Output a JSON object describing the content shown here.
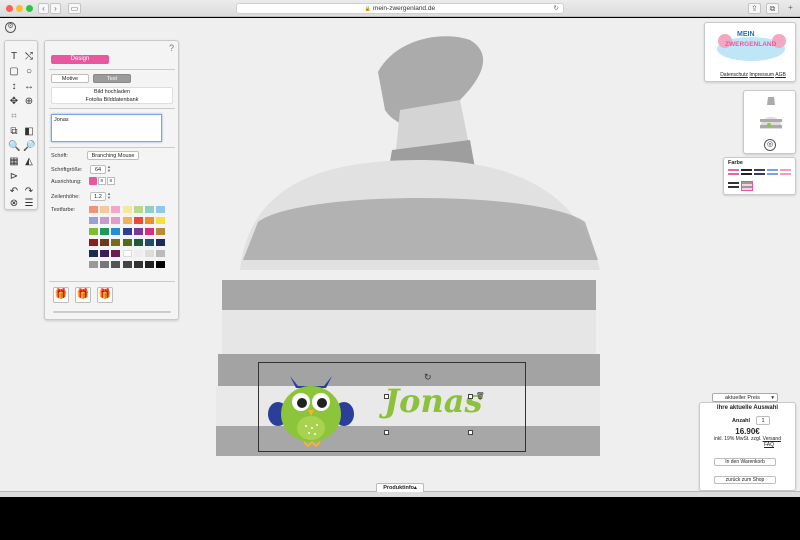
{
  "browser": {
    "url": "mein-zwergenland.de"
  },
  "designer": {
    "help_label": "?",
    "design_tab": "Design",
    "motive_tab": "Motive",
    "text_tab": "Text",
    "upload_label": "Bild hochladen",
    "fotolia_label": "Fotolia Bilddatenbank",
    "text_value": "Jonas",
    "font_label": "Schrift:",
    "font_value": "Branching Mouse",
    "size_label": "Schriftgröße:",
    "size_value": "64",
    "align_label": "Ausrichtung:",
    "lineheight_label": "Zeilenhöhe:",
    "lineheight_value": "1.2",
    "textcolor_label": "Textfarbe:",
    "palette": [
      "#f0937a",
      "#f6c7a0",
      "#f4a6c6",
      "#f7e79b",
      "#b9d98a",
      "#8fd0c4",
      "#8fc8ee",
      "#9aa0d6",
      "#c59ad3",
      "#e59ac9",
      "#f4b14f",
      "#e94a3a",
      "#f08c2b",
      "#f6e03c",
      "#7fba2f",
      "#1c9a5a",
      "#1f8fd6",
      "#2f3e8f",
      "#7a3a94",
      "#d62f7d",
      "#b88a3a",
      "#8b1e1e",
      "#6a3b1e",
      "#7a6a1e",
      "#4e6b1e",
      "#1e5a3a",
      "#1e4e6b",
      "#1e2a5a",
      "#1e2a4e",
      "#3a1e5a",
      "#6a1e4e",
      "#ffffff",
      "#eeeeee",
      "#dddddd",
      "#bbbbbb",
      "#999999",
      "#777777",
      "#555555",
      "#444444",
      "#333333",
      "#222222",
      "#000000"
    ]
  },
  "logo": {
    "line1": "MEIN",
    "line2": "ZWERGENLAND",
    "privacy": "Datenschutz",
    "imprint": "Impressum",
    "agb": "AGB"
  },
  "colors_panel": {
    "title": "Farbe"
  },
  "design": {
    "name_text": "Jonas"
  },
  "price_panel": {
    "dropdown": "aktueller Preis",
    "title": "Ihre aktuelle Auswahl",
    "qty_label": "Anzahl",
    "qty_value": "1",
    "price": "16.90€",
    "tax_note_1": "inkl. 19% MwSt. zzgl.",
    "shipping_link": "Versand",
    "faq_link": "FAQ",
    "cart_button": "In den Warenkorb",
    "back_button": "zurück zum Shop"
  },
  "product_info_tab": "Produktinfo"
}
